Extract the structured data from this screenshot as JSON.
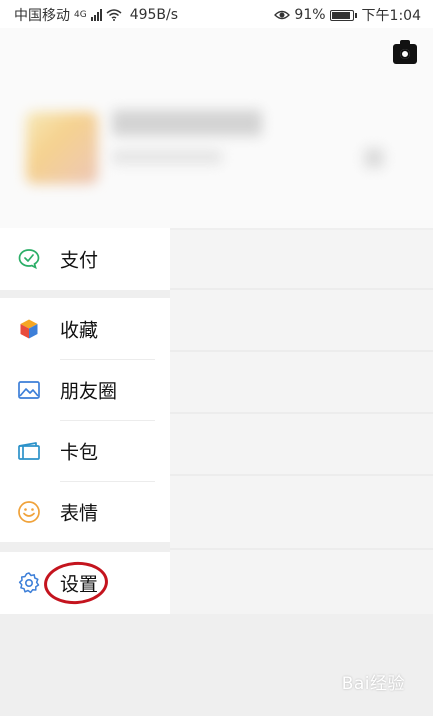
{
  "status_bar": {
    "carrier": "中国移动",
    "network": "4G",
    "speed": "495B/s",
    "battery": "91%",
    "time": "下午1:04",
    "battery_level": 0.91
  },
  "header": {
    "camera_icon": "camera-icon"
  },
  "menu": {
    "pay": {
      "label": "支付",
      "icon": "wechat-pay-icon",
      "color": "#2bae67"
    },
    "favorites": {
      "label": "收藏",
      "icon": "cube-icon"
    },
    "moments": {
      "label": "朋友圈",
      "icon": "image-icon",
      "color": "#3d7fd8"
    },
    "cards": {
      "label": "卡包",
      "icon": "card-icon",
      "color": "#2c92c9"
    },
    "stickers": {
      "label": "表情",
      "icon": "smiley-icon",
      "color": "#f0a23a"
    },
    "settings": {
      "label": "设置",
      "icon": "gear-icon",
      "color": "#3d7fd8"
    }
  },
  "watermark": "Bai经验",
  "colors": {
    "annotation": "#c4141e",
    "background": "#efefef"
  }
}
